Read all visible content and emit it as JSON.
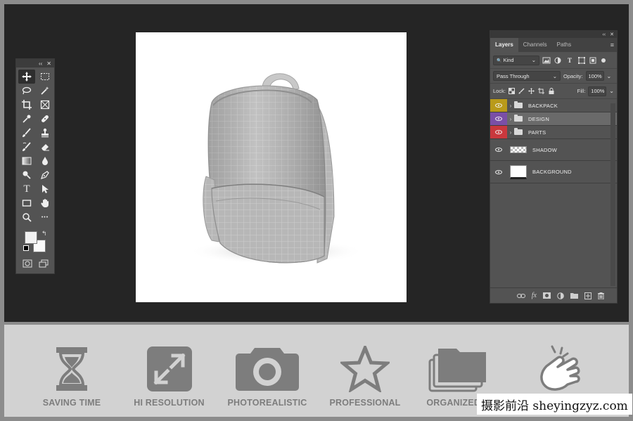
{
  "tools_panel": {
    "collapse_glyph": "‹‹",
    "close_glyph": "✕",
    "tools": [
      {
        "name": "move-tool",
        "icon": "move-icon",
        "active": true
      },
      {
        "name": "marquee-tool",
        "icon": "marquee-icon"
      },
      {
        "name": "lasso-tool",
        "icon": "lasso-icon"
      },
      {
        "name": "magic-wand-tool",
        "icon": "magic-wand-icon"
      },
      {
        "name": "crop-tool",
        "icon": "crop-icon"
      },
      {
        "name": "frame-tool",
        "icon": "frame-icon"
      },
      {
        "name": "eyedropper-tool",
        "icon": "eyedropper-icon"
      },
      {
        "name": "healing-tool",
        "icon": "bandage-icon"
      },
      {
        "name": "brush-tool",
        "icon": "brush-icon"
      },
      {
        "name": "stamp-tool",
        "icon": "stamp-icon"
      },
      {
        "name": "history-brush-tool",
        "icon": "history-brush-icon"
      },
      {
        "name": "eraser-tool",
        "icon": "eraser-icon"
      },
      {
        "name": "gradient-tool",
        "icon": "gradient-icon"
      },
      {
        "name": "blur-tool",
        "icon": "drop-icon"
      },
      {
        "name": "dodge-tool",
        "icon": "dodge-icon"
      },
      {
        "name": "pen-tool",
        "icon": "pen-icon"
      },
      {
        "name": "type-tool",
        "icon": "type-icon"
      },
      {
        "name": "path-select-tool",
        "icon": "arrow-icon"
      },
      {
        "name": "shape-tool",
        "icon": "rectangle-icon"
      },
      {
        "name": "hand-tool",
        "icon": "hand-icon"
      },
      {
        "name": "zoom-tool",
        "icon": "magnifier-icon"
      },
      {
        "name": "more-tools",
        "icon": "ellipsis-icon"
      }
    ],
    "type_glyph": "T",
    "ellipsis_glyph": "•••",
    "swap_glyph": "↰"
  },
  "layers_panel": {
    "collapse_glyph": "‹‹",
    "close_glyph": "✕",
    "tabs": [
      {
        "label": "Layers",
        "active": true
      },
      {
        "label": "Channels",
        "active": false
      },
      {
        "label": "Paths",
        "active": false
      }
    ],
    "menu_glyph": "≡",
    "filter": {
      "label": "Kind",
      "icon_glyph": "🔍",
      "chevron": "⌄"
    },
    "blend_mode": "Pass Through",
    "opacity_label": "Opacity:",
    "opacity_value": "100%",
    "lock_label": "Lock:",
    "fill_label": "Fill:",
    "fill_value": "100%",
    "layers": [
      {
        "name": "BACKPACK",
        "kind": "group",
        "color": "#b99a1a",
        "selected": false
      },
      {
        "name": "DESIGN",
        "kind": "group",
        "color": "#7a4fa6",
        "selected": true
      },
      {
        "name": "PARTS",
        "kind": "group",
        "color": "#c9383d",
        "selected": false
      },
      {
        "name": "SHADOW",
        "kind": "layer",
        "thumb": "checker"
      },
      {
        "name": "BACKGROUND",
        "kind": "layer",
        "thumb": "white"
      }
    ],
    "footer_icons": [
      "link-icon",
      "fx-icon",
      "mask-icon",
      "adjustment-icon",
      "new-group-icon",
      "new-layer-icon",
      "trash-icon"
    ],
    "fx_glyph": "fx"
  },
  "features": [
    {
      "label": "SAVING TIME",
      "icon": "hourglass-icon"
    },
    {
      "label": "HI RESOLUTION",
      "icon": "expand-icon"
    },
    {
      "label": "PHOTOREALISTIC",
      "icon": "camera-icon"
    },
    {
      "label": "PROFESSIONAL",
      "icon": "star-icon"
    },
    {
      "label": "ORGANIZED L",
      "icon": "folders-icon"
    },
    {
      "label": "",
      "icon": "hand-tap-icon"
    }
  ],
  "watermark": "摄影前沿 sheyingzyz.com",
  "colors": {
    "workspace": "#252525",
    "panel": "#535353",
    "band": "#d2d2d2",
    "feature_gray": "#7d7d7d"
  }
}
